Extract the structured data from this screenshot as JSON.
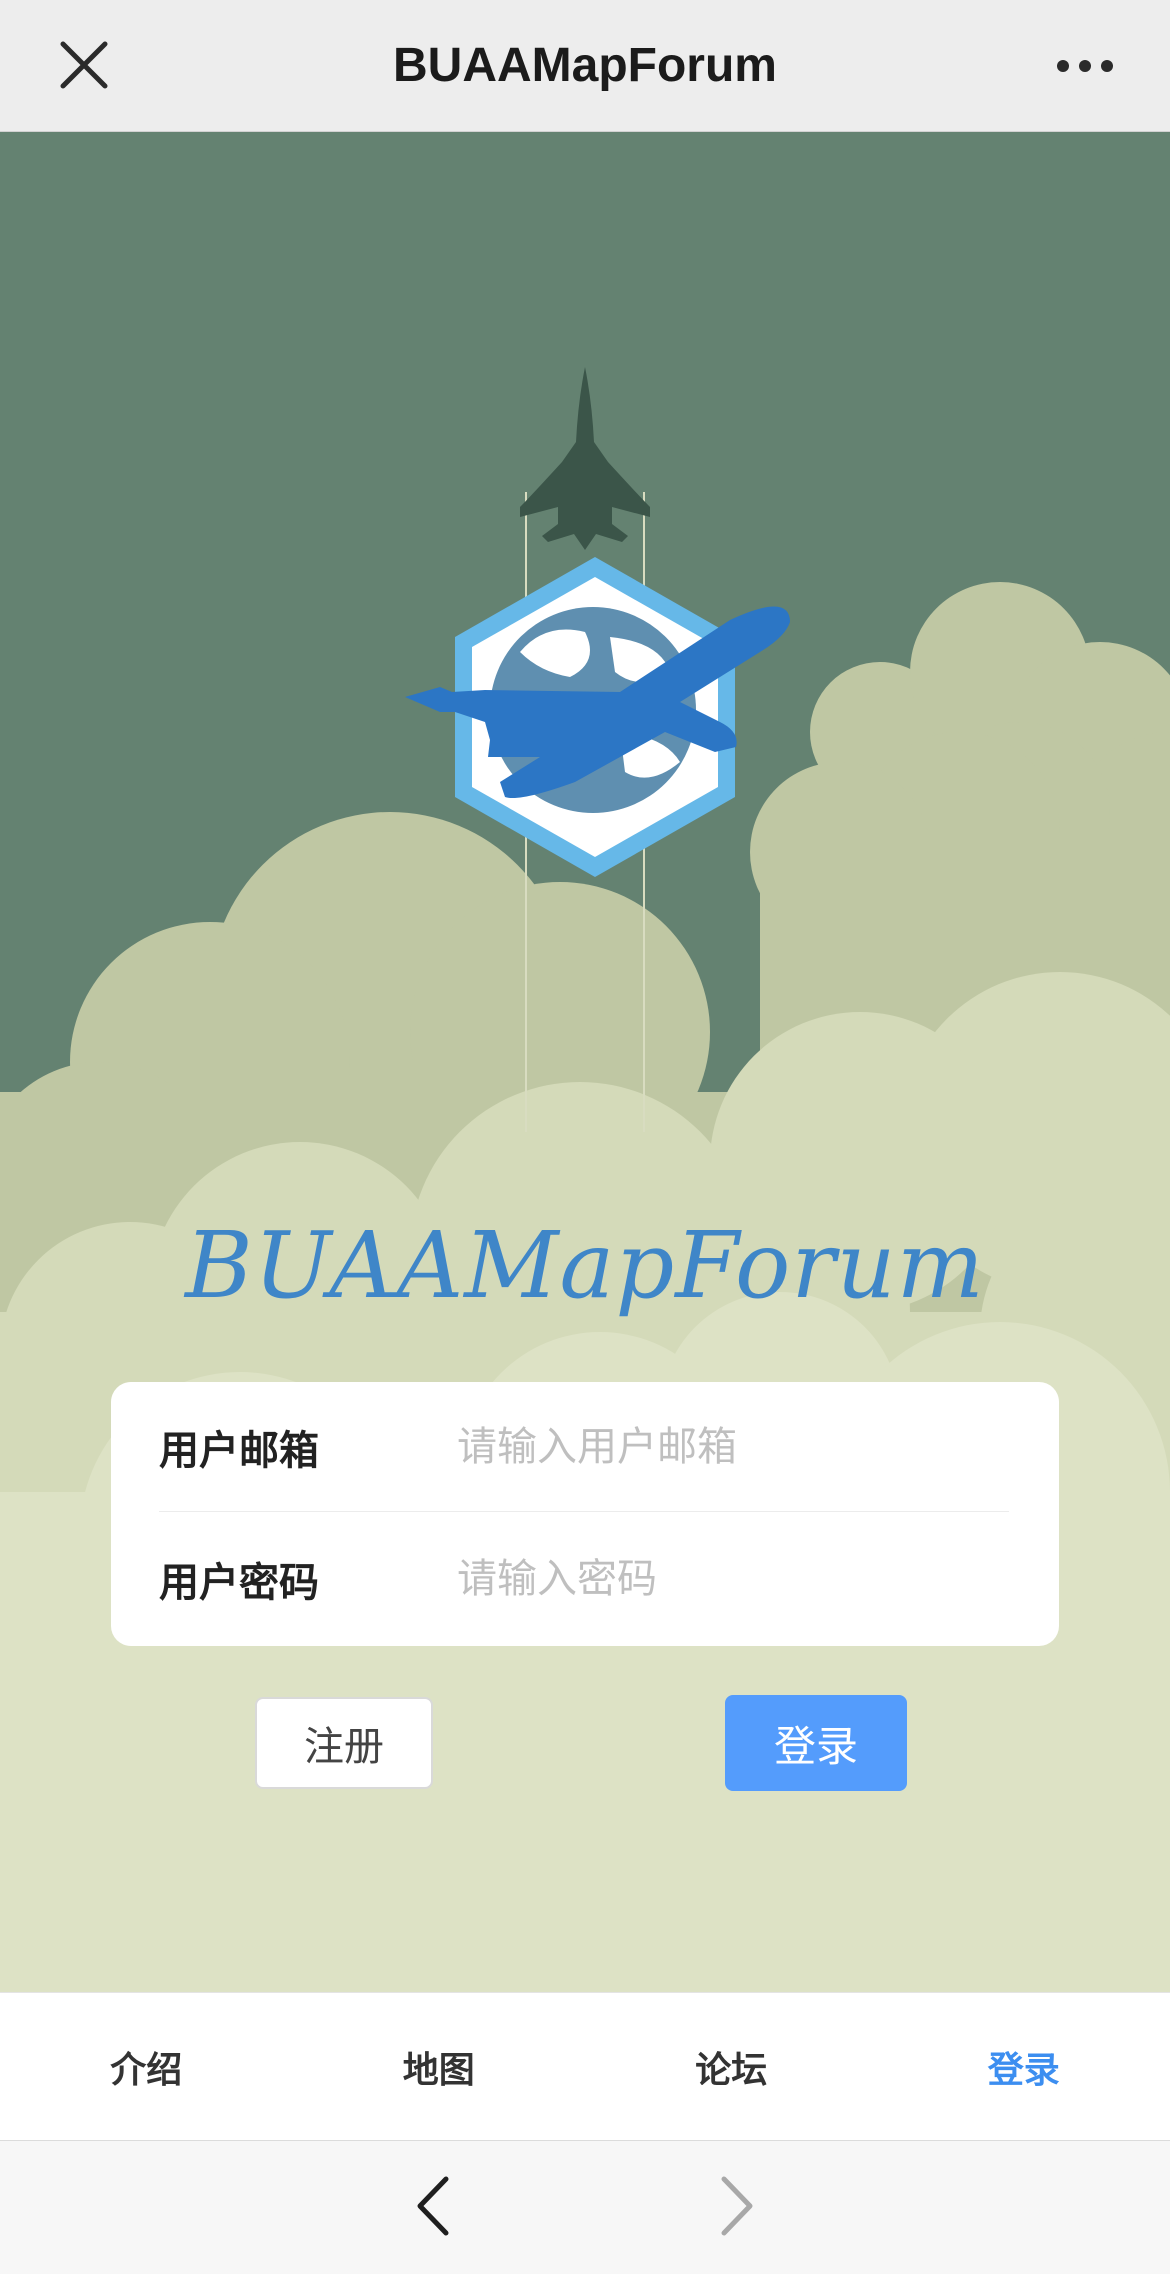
{
  "window": {
    "title": "BUAAMapForum",
    "close_icon": "close-icon",
    "more_icon": "more-dots-icon"
  },
  "hero": {
    "brand_text": "BUAAMapForum",
    "logo_icon": "hexagon-globe-airplane-logo",
    "jet_icon": "fighter-jet-silhouette",
    "colors": {
      "sky": "#648271",
      "cloud_light": "#dde2c5",
      "cloud_mid": "#bfc7a3",
      "logo_blue": "#3f86c8"
    }
  },
  "form": {
    "email": {
      "label": "用户邮箱",
      "placeholder": "请输入用户邮箱",
      "value": ""
    },
    "password": {
      "label": "用户密码",
      "placeholder": "请输入密码",
      "value": ""
    },
    "register_label": "注册",
    "login_label": "登录",
    "login_color": "#549cfc"
  },
  "tabs": [
    {
      "label": "介绍"
    },
    {
      "label": "地图"
    },
    {
      "label": "论坛"
    },
    {
      "label": "登录",
      "active": true
    }
  ],
  "browser_nav": {
    "back_icon": "chevron-left-icon",
    "forward_icon": "chevron-right-icon"
  }
}
